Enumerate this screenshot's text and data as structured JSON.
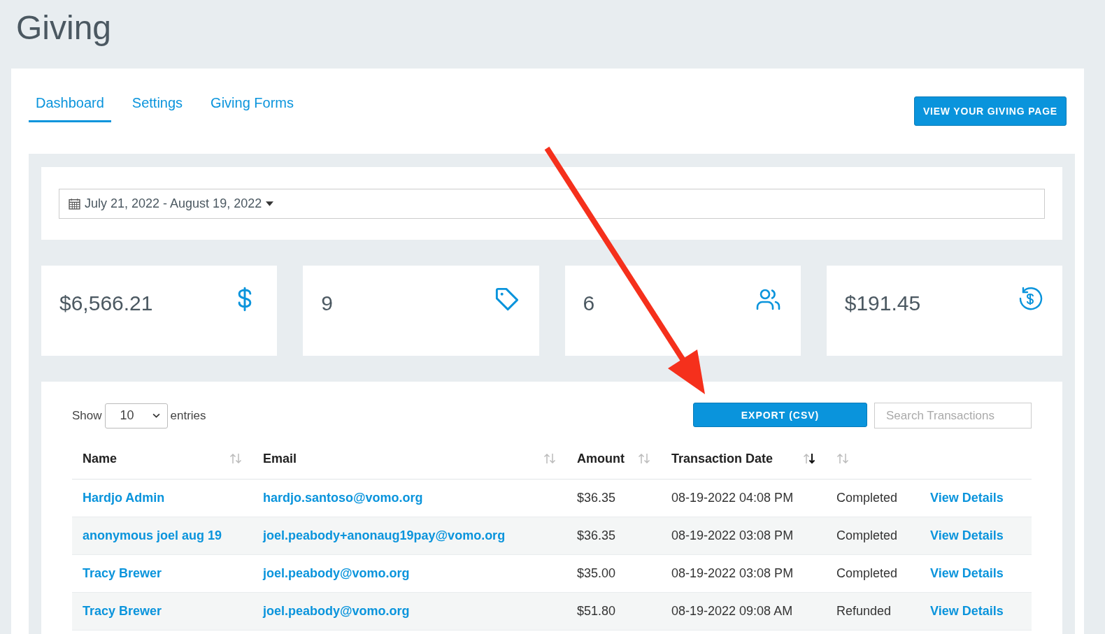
{
  "page_title": "Giving",
  "tabs": [
    {
      "label": "Dashboard",
      "selected": true
    },
    {
      "label": "Settings",
      "selected": false
    },
    {
      "label": "Giving Forms",
      "selected": false
    }
  ],
  "view_page_button": "VIEW YOUR GIVING PAGE",
  "date_range": {
    "value": "July 21, 2022 - August 19, 2022"
  },
  "stats": [
    {
      "value": "$6,566.21",
      "kind": "dollar"
    },
    {
      "value": "9",
      "kind": "tag"
    },
    {
      "value": "6",
      "kind": "users"
    },
    {
      "value": "$191.45",
      "kind": "refund"
    }
  ],
  "table_controls": {
    "show_label": "Show",
    "page_size": "10",
    "entries_label": "entries",
    "export_button": "EXPORT (CSV)",
    "search": {
      "placeholder": "Search Transactions"
    }
  },
  "columns": [
    {
      "label": "Name",
      "sortable": true,
      "sorted": false
    },
    {
      "label": "Email",
      "sortable": true,
      "sorted": false
    },
    {
      "label": "Amount",
      "sortable": true,
      "sorted": false
    },
    {
      "label": "Transaction Date",
      "sortable": true,
      "sorted": true
    },
    {
      "sortable": true,
      "sorted": false
    }
  ],
  "rows": [
    {
      "name": "Hardjo Admin",
      "email": "hardjo.santoso@vomo.org",
      "amount": "$36.35",
      "date": "08-19-2022 04:08 PM",
      "status": "Completed",
      "link": "View Details"
    },
    {
      "name": "anonymous joel aug 19",
      "email": "joel.peabody+anonaug19pay@vomo.org",
      "amount": "$36.35",
      "date": "08-19-2022 03:08 PM",
      "status": "Completed",
      "link": "View Details"
    },
    {
      "name": "Tracy Brewer",
      "email": "joel.peabody@vomo.org",
      "amount": "$35.00",
      "date": "08-19-2022 03:08 PM",
      "status": "Completed",
      "link": "View Details"
    },
    {
      "name": "Tracy Brewer",
      "email": "joel.peabody@vomo.org",
      "amount": "$51.80",
      "date": "08-19-2022 09:08 AM",
      "status": "Refunded",
      "link": "View Details"
    }
  ]
}
